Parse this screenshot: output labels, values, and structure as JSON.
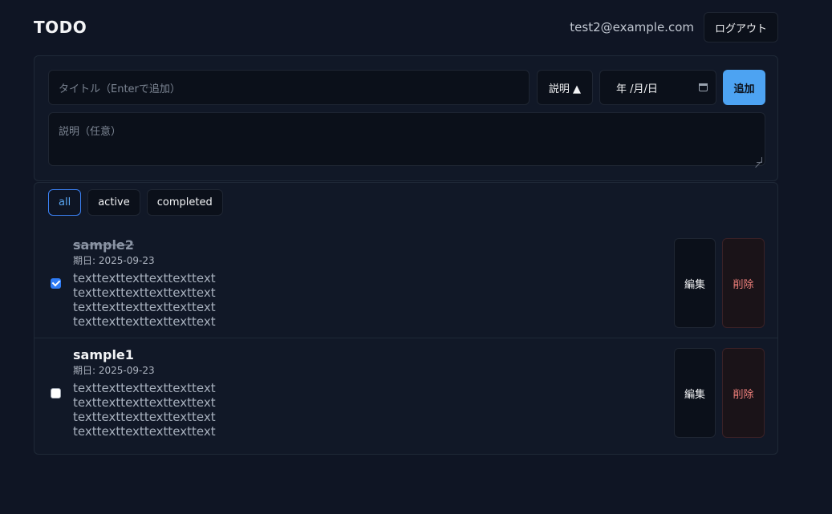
{
  "header": {
    "brand": "TODO",
    "user_email": "test2@example.com",
    "logout_label": "ログアウト"
  },
  "form": {
    "title_placeholder": "タイトル（Enterで追加）",
    "desc_toggle_label": "説明 ▲",
    "date_display": "年 /月/日",
    "add_label": "追加",
    "desc_placeholder": "説明（任意）"
  },
  "filters": [
    {
      "label": "all",
      "active": true
    },
    {
      "label": "active",
      "active": false
    },
    {
      "label": "completed",
      "active": false
    }
  ],
  "todos": [
    {
      "title": "sample2",
      "completed": true,
      "due": "期日: 2025-09-23",
      "desc": [
        "texttexttexttexttexttext",
        "texttexttexttexttexttext",
        "texttexttexttexttexttext",
        "texttexttexttexttexttext"
      ],
      "edit_label": "編集",
      "delete_label": "削除"
    },
    {
      "title": "sample1",
      "completed": false,
      "due": "期日: 2025-09-23",
      "desc": [
        "texttexttexttexttexttext",
        "texttexttexttexttexttext",
        "texttexttexttexttexttext",
        "texttexttexttexttexttext"
      ],
      "edit_label": "編集",
      "delete_label": "削除"
    }
  ],
  "colors": {
    "background": "#0f1524",
    "accent": "#4da3f2",
    "danger": "#f2817c"
  }
}
